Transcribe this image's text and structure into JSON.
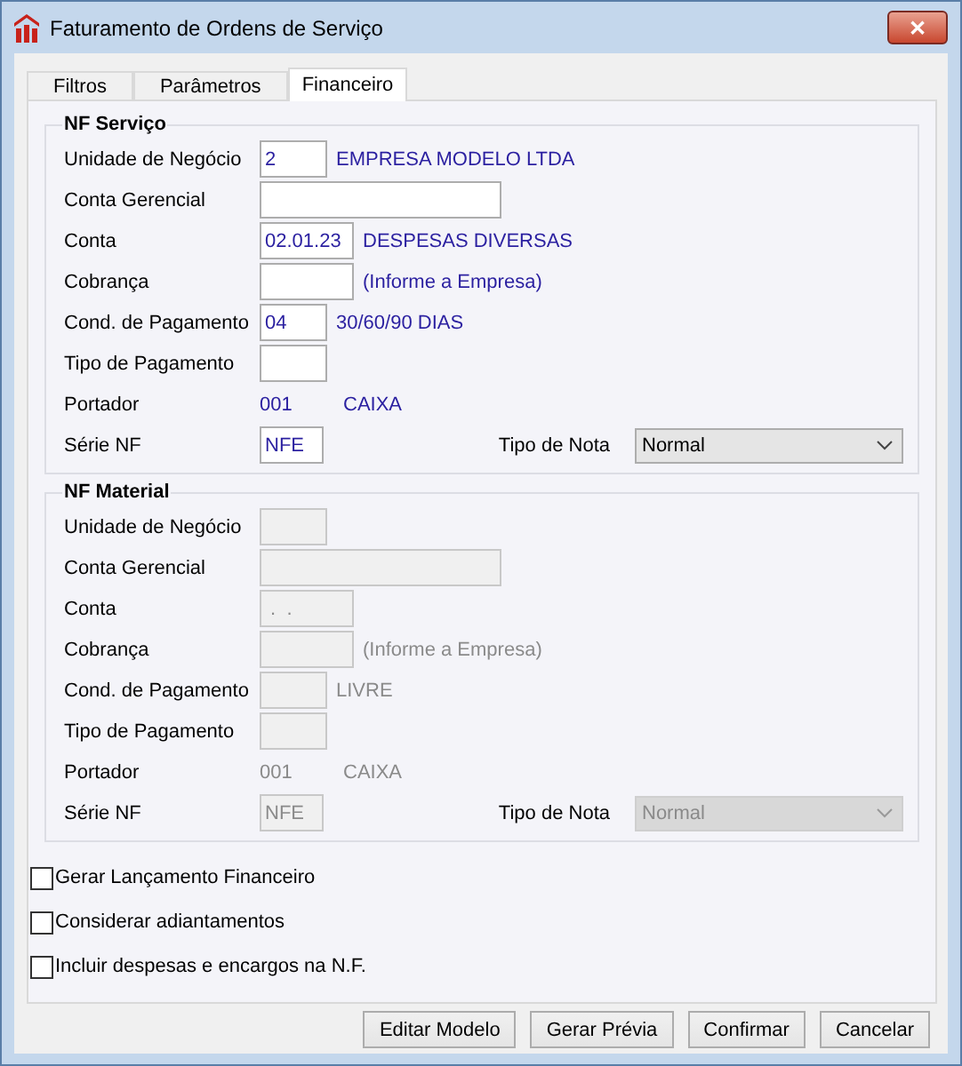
{
  "window": {
    "title": "Faturamento de Ordens de Serviço",
    "close": "✕"
  },
  "tabs": [
    {
      "label": "Filtros",
      "selected": false
    },
    {
      "label": "Parâmetros",
      "selected": false
    },
    {
      "label": "Financeiro",
      "selected": true
    }
  ],
  "groups": [
    {
      "title": "NF Serviço",
      "disabled": false,
      "rows": [
        {
          "kind": "short_field",
          "label": "Unidade de Negócio",
          "value": "2",
          "note": "EMPRESA MODELO LTDA"
        },
        {
          "kind": "long_field",
          "label": "Conta Gerencial",
          "value": ""
        },
        {
          "kind": "medium_field",
          "label": "Conta",
          "value": "02.01.23",
          "note": "DESPESAS DIVERSAS"
        },
        {
          "kind": "medium_field",
          "label": "Cobrança",
          "value": "",
          "note": "(Informe a Empresa)"
        },
        {
          "kind": "short_field",
          "label": "Cond. de Pagamento",
          "value": "04",
          "note": "30/60/90 DIAS"
        },
        {
          "kind": "short_field",
          "label": "Tipo de Pagamento",
          "value": ""
        },
        {
          "kind": "readout",
          "label": "Portador",
          "code": "001",
          "name": "CAIXA"
        },
        {
          "kind": "serie",
          "label": "Série NF",
          "value": "NFE",
          "select_label": "Tipo de Nota",
          "select_value": "Normal"
        }
      ]
    },
    {
      "title": "NF Material",
      "disabled": true,
      "rows": [
        {
          "kind": "short_field",
          "label": "Unidade de Negócio",
          "value": ""
        },
        {
          "kind": "long_field",
          "label": "Conta Gerencial",
          "value": ""
        },
        {
          "kind": "medium_field",
          "label": "Conta",
          "value": " .  ."
        },
        {
          "kind": "medium_field",
          "label": "Cobrança",
          "value": "",
          "note": "(Informe a Empresa)"
        },
        {
          "kind": "short_field",
          "label": "Cond. de Pagamento",
          "value": "",
          "note": "LIVRE"
        },
        {
          "kind": "short_field",
          "label": "Tipo de Pagamento",
          "value": ""
        },
        {
          "kind": "readout",
          "label": "Portador",
          "code": "001",
          "name": "CAIXA"
        },
        {
          "kind": "serie",
          "label": "Série NF",
          "value": "NFE",
          "select_label": "Tipo de Nota",
          "select_value": "Normal"
        }
      ]
    }
  ],
  "options": [
    {
      "label": "Gerar Lançamento Financeiro",
      "checked": false
    },
    {
      "label": "Considerar adiantamentos",
      "checked": false
    },
    {
      "label": "Incluir despesas e encargos na N.F.",
      "checked": false
    }
  ],
  "buttons": [
    "Editar Modelo",
    "Gerar Prévia",
    "Confirmar",
    "Cancelar"
  ]
}
